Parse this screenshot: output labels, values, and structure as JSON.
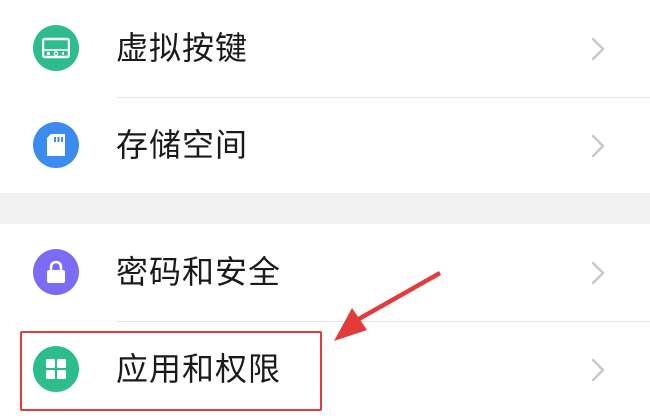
{
  "settings": {
    "items": [
      {
        "label": "虚拟按键",
        "icon": "virtual-keys-icon",
        "color": "#2dbd8c"
      },
      {
        "label": "存储空间",
        "icon": "storage-icon",
        "color": "#3b8cee"
      },
      {
        "label": "密码和安全",
        "icon": "lock-icon",
        "color": "#7b6cf6"
      },
      {
        "label": "应用和权限",
        "icon": "apps-grid-icon",
        "color": "#2dbd8c"
      }
    ]
  },
  "annotation": {
    "highlight_color": "#e33a3a"
  }
}
